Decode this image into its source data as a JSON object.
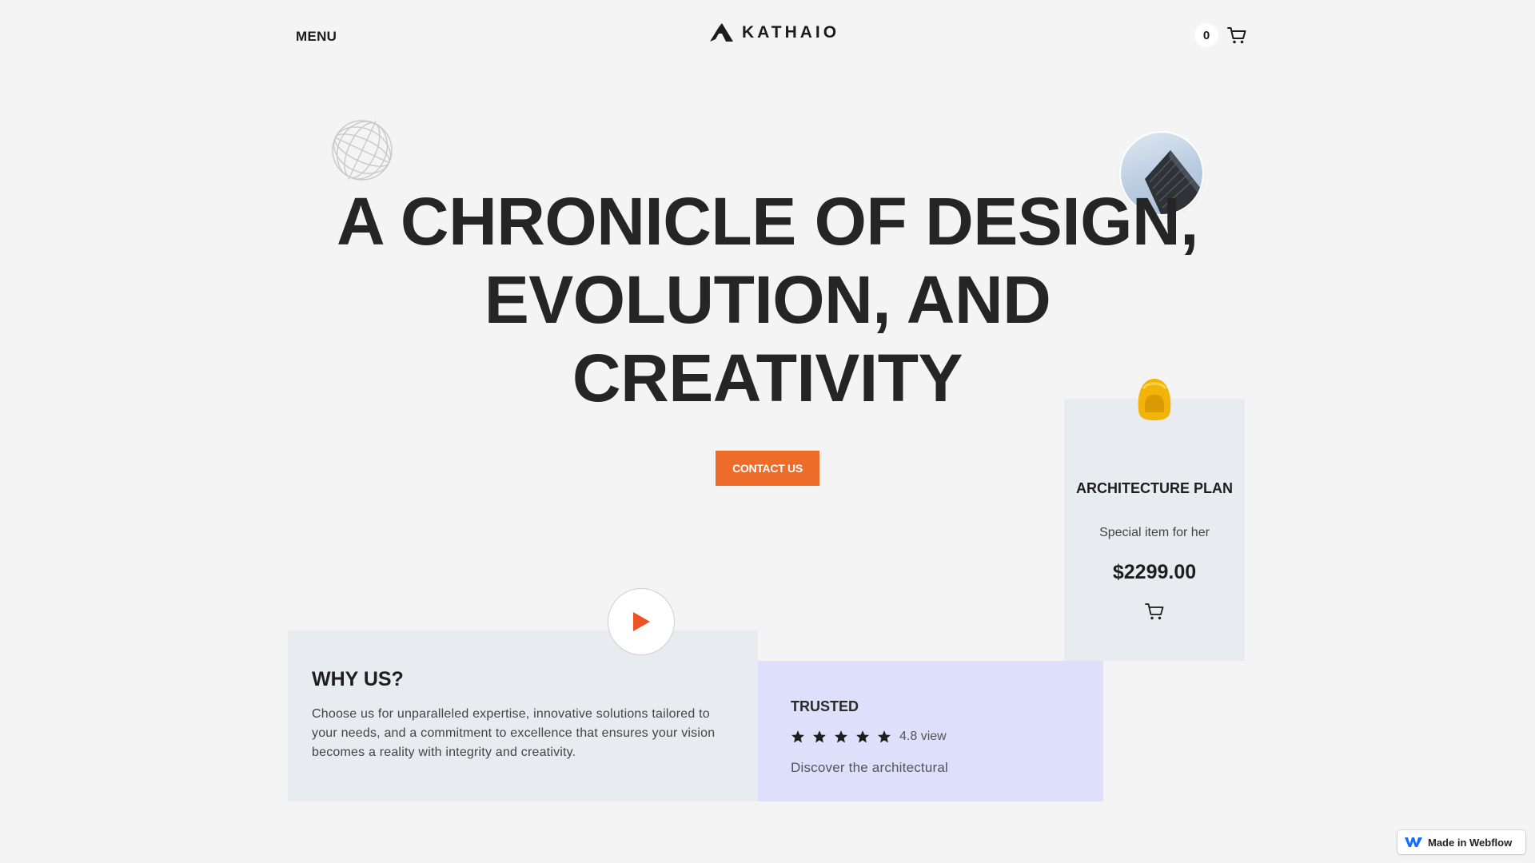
{
  "header": {
    "menu_label": "MENU",
    "logo_text": "KATHAIO",
    "cart_count": "0"
  },
  "hero": {
    "title": "A CHRONICLE OF DESIGN, EVOLUTION, AND CREATIVITY",
    "cta_label": "CONTACT US"
  },
  "product": {
    "title": "ARCHITECTURE PLAN",
    "subtitle": "Special item for her",
    "price": "$2299.00"
  },
  "why_us": {
    "title": "WHY US?",
    "text": "Choose us for unparalleled expertise, innovative solutions tailored to your needs, and a commitment to excellence that ensures your vision becomes a reality with integrity and creativity."
  },
  "trusted": {
    "title": "TRUSTED",
    "rating": 5,
    "rating_text": "4.8 view",
    "description": "Discover the architectural"
  },
  "badge": {
    "label": "Made in Webflow"
  },
  "colors": {
    "background": "#f4f4f4",
    "accent": "#ee6c2a",
    "card_gray": "#e8ebef",
    "card_lavender": "#dedffa",
    "play_red": "#ee5326"
  },
  "icons": [
    "logo-icon",
    "cart-icon",
    "globe-icon",
    "building-photo",
    "helmet-icon",
    "play-icon",
    "star-icon",
    "webflow-logo-icon"
  ]
}
